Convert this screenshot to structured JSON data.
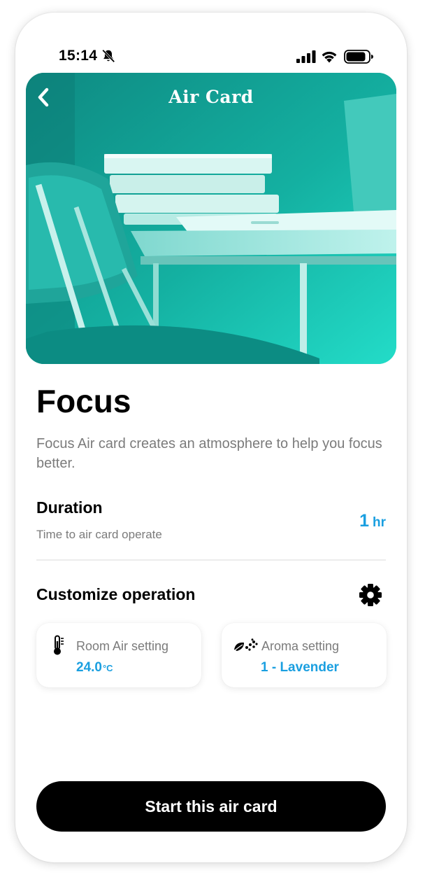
{
  "status_bar": {
    "time": "15:14"
  },
  "header": {
    "title": "Air Card"
  },
  "card": {
    "name": "Focus",
    "description": "Focus Air card creates an atmosphere to help you focus better."
  },
  "duration": {
    "title": "Duration",
    "subtitle": "Time to air card operate",
    "value": "1",
    "unit": "hr"
  },
  "customize": {
    "title": "Customize operation",
    "room_air": {
      "label": "Room Air setting",
      "value": "24.0",
      "unit": "°C"
    },
    "aroma": {
      "label": "Aroma setting",
      "value": "1 - Lavender"
    }
  },
  "action": {
    "start_label": "Start this air card"
  },
  "colors": {
    "accent": "#1a9fe0",
    "hero": "#13b5a5",
    "button": "#000000"
  }
}
